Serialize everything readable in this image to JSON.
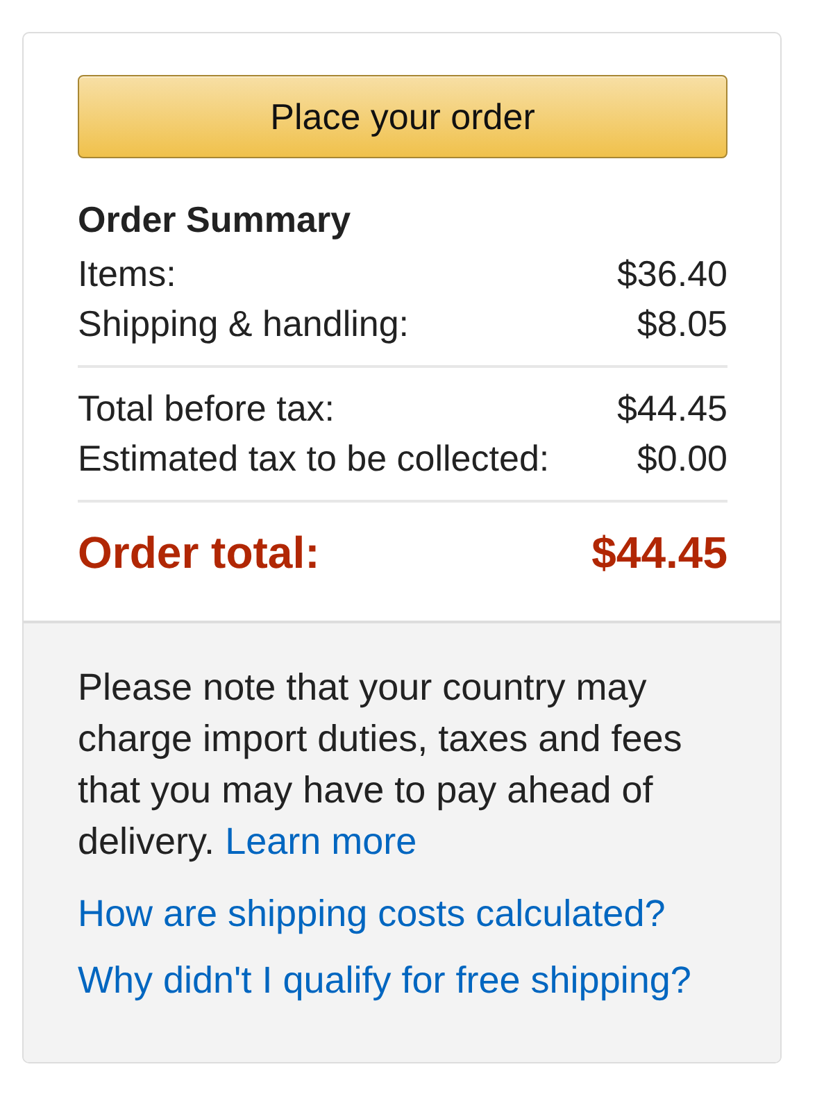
{
  "place_order_button": {
    "label": "Place your order"
  },
  "order_summary": {
    "title": "Order Summary",
    "sections": [
      {
        "lines": [
          {
            "label": "Items:",
            "amount": "$36.40"
          },
          {
            "label": "Shipping & handling:",
            "amount": "$8.05"
          }
        ]
      },
      {
        "lines": [
          {
            "label": "Total before tax:",
            "amount": "$44.45"
          },
          {
            "label": "Estimated tax to be collected:",
            "amount": "$0.00"
          }
        ]
      }
    ],
    "total": {
      "label": "Order total:",
      "amount": "$44.45"
    }
  },
  "notice": {
    "text": "Please note that your country may charge import duties, taxes and fees that you may have to pay ahead of delivery.",
    "link": "Learn more"
  },
  "help_links": [
    "How are shipping costs calculated?",
    "Why didn't I qualify for free shipping?"
  ]
}
